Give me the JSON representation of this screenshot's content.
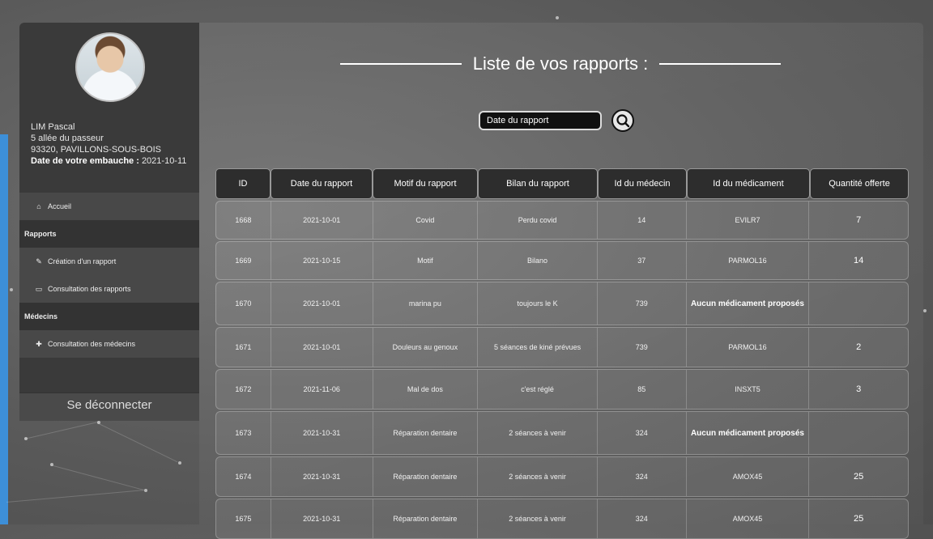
{
  "profile": {
    "name": "LIM Pascal",
    "address": "5 allée du passeur",
    "city": "93320, PAVILLONS-SOUS-BOIS",
    "hire_label": "Date de votre embauche :",
    "hire_date": "2021-10-11"
  },
  "menu": {
    "home": "Accueil",
    "reports_heading": "Rapports",
    "create_report": "Création d'un rapport",
    "consult_reports": "Consultation des rapports",
    "doctors_heading": "Médecins",
    "consult_doctors": "Consultation des médecins"
  },
  "logout_label": "Se déconnecter",
  "page_title": "Liste de vos rapports :",
  "search": {
    "placeholder": "Date du rapport"
  },
  "table": {
    "headers": [
      "ID",
      "Date du rapport",
      "Motif du rapport",
      "Bilan du rapport",
      "Id du médecin",
      "Id du médicament",
      "Quantité offerte"
    ],
    "rows": [
      [
        "1668",
        "2021-10-01",
        "Covid",
        "Perdu covid",
        "14",
        "EVILR7",
        "7"
      ],
      [
        "1669",
        "2021-10-15",
        "Motif",
        "Bilano",
        "37",
        "PARMOL16",
        "14"
      ],
      [
        "1670",
        "2021-10-01",
        "marina pu",
        "toujours le K",
        "739",
        "Aucun médicament proposés",
        ""
      ],
      [
        "1671",
        "2021-10-01",
        "Douleurs au genoux",
        "5 séances de kiné prévues",
        "739",
        "PARMOL16",
        "2"
      ],
      [
        "1672",
        "2021-11-06",
        "Mal de dos",
        "c'est réglé",
        "85",
        "INSXT5",
        "3"
      ],
      [
        "1673",
        "2021-10-31",
        "Réparation dentaire",
        "2 séances à venir",
        "324",
        "Aucun médicament proposés",
        ""
      ],
      [
        "1674",
        "2021-10-31",
        "Réparation dentaire",
        "2 séances à venir",
        "324",
        "AMOX45",
        "25"
      ],
      [
        "1675",
        "2021-10-31",
        "Réparation dentaire",
        "2 séances à venir",
        "324",
        "AMOX45",
        "25"
      ]
    ]
  },
  "colors": {
    "accent_blue": "#3d8fd8",
    "sidebar": "#3a3a3a"
  },
  "icons": {
    "home": "home-icon",
    "create": "edit-icon",
    "consult": "book-icon",
    "doctors": "plus-icon",
    "search": "search-icon"
  }
}
